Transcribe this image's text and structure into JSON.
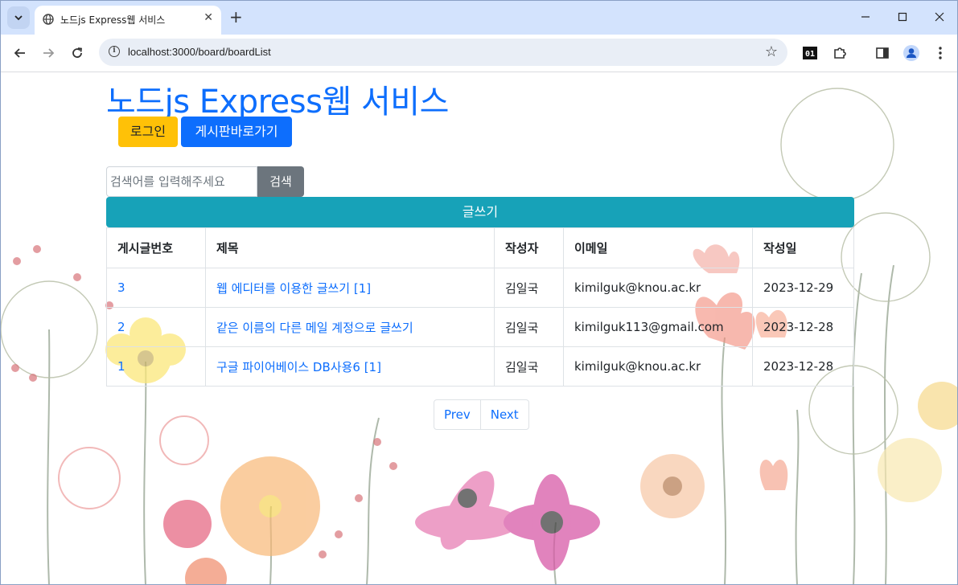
{
  "browser": {
    "tab_title": "노드js Express웹 서비스",
    "url": "localhost:3000/board/boardList",
    "window_controls": [
      "minimize",
      "maximize",
      "close"
    ]
  },
  "page": {
    "site_title": "노드js Express웹 서비스",
    "login_button": "로그인",
    "board_button": "게시판바로가기",
    "search_placeholder": "검색어를 입력해주세요",
    "search_button": "검색",
    "write_button": "글쓰기",
    "table": {
      "headers": [
        "게시글번호",
        "제목",
        "작성자",
        "이메일",
        "작성일"
      ],
      "rows": [
        {
          "no": "3",
          "title": "웹 에디터를 이용한 글쓰기 [1]",
          "author": "김일국",
          "email": "kimilguk@knou.ac.kr",
          "date": "2023-12-29"
        },
        {
          "no": "2",
          "title": "같은 이름의 다른 메일 계정으로 글쓰기",
          "author": "김일국",
          "email": "kimilguk113@gmail.com",
          "date": "2023-12-28"
        },
        {
          "no": "1",
          "title": "구글 파이어베이스 DB사용6 [1]",
          "author": "김일국",
          "email": "kimilguk@knou.ac.kr",
          "date": "2023-12-28"
        }
      ]
    },
    "pager": {
      "prev": "Prev",
      "next": "Next"
    }
  },
  "colors": {
    "primary": "#0d6efd",
    "warning": "#ffc107",
    "info": "#17a2b8",
    "secondary": "#6c757d",
    "tabstrip": "#d3e3fd"
  }
}
